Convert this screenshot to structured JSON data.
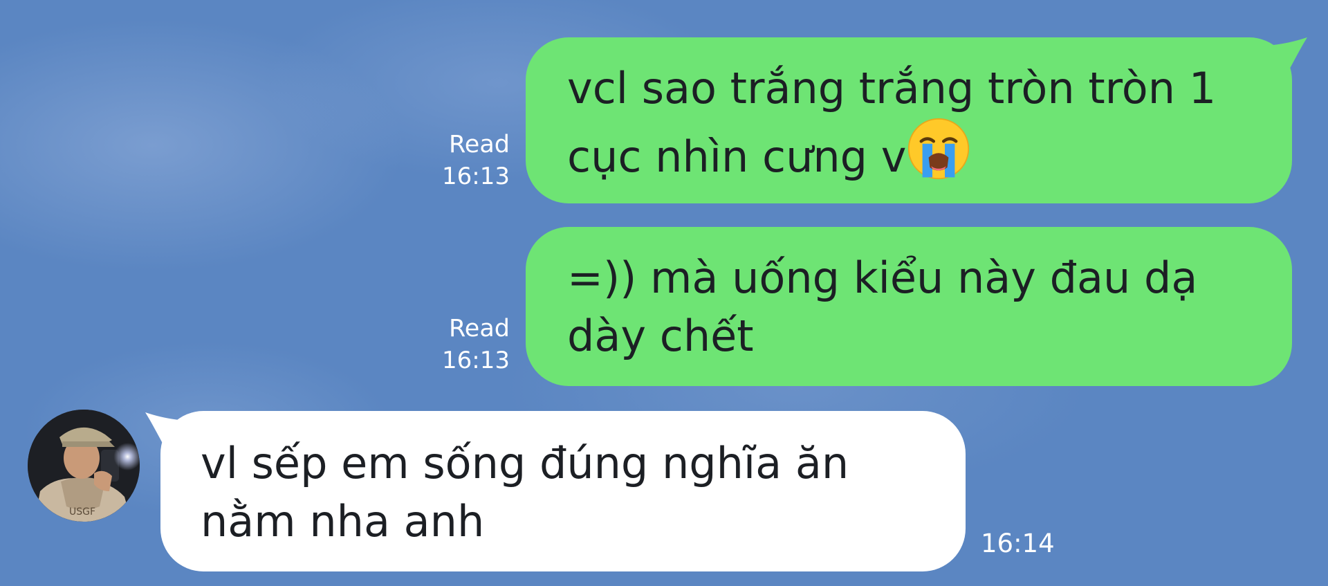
{
  "messages": [
    {
      "direction": "outgoing",
      "lines": [
        "vcl sao trắng trắng tròn tròn 1",
        "cục nhìn cưng v"
      ],
      "emoji": "loudly-crying-face",
      "status": "Read",
      "time": "16:13"
    },
    {
      "direction": "outgoing",
      "lines": [
        "=)) mà uống kiểu này đau dạ",
        "dày chết"
      ],
      "status": "Read",
      "time": "16:13"
    },
    {
      "direction": "incoming",
      "lines": [
        "vl sếp em sống đúng nghĩa ăn",
        "nằm nha anh"
      ],
      "time": "16:14",
      "sender_avatar": "contact-avatar"
    }
  ],
  "colors": {
    "background": "#5b86c2",
    "outgoing_bubble": "#6ee474",
    "incoming_bubble": "#ffffff",
    "meta_text": "#ffffff",
    "message_text": "#1c1f24"
  }
}
